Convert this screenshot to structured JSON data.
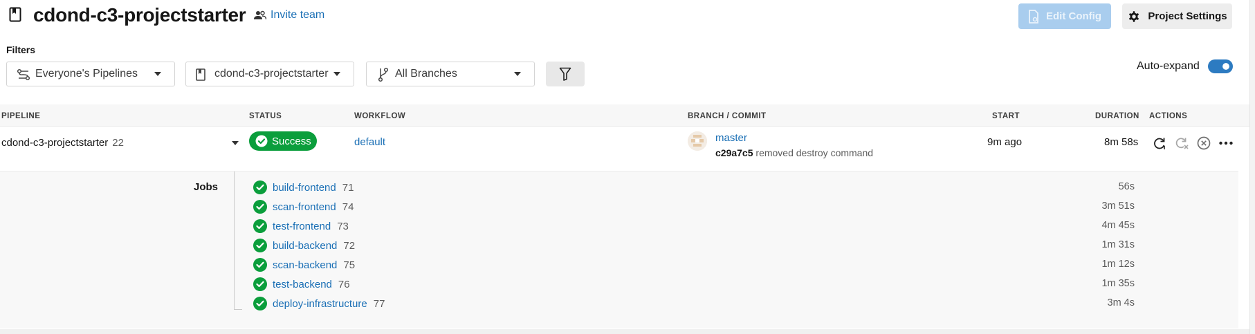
{
  "header": {
    "project_title": "cdond-c3-projectstarter",
    "invite_label": "Invite team",
    "edit_config_label": "Edit Config",
    "project_settings_label": "Project Settings"
  },
  "filters": {
    "label": "Filters",
    "pipelines_select": "Everyone's Pipelines",
    "project_select": "cdond-c3-projectstarter",
    "branches_select": "All Branches",
    "auto_expand_label": "Auto-expand",
    "auto_expand_on": true
  },
  "table": {
    "columns": [
      "PIPELINE",
      "STATUS",
      "WORKFLOW",
      "BRANCH / COMMIT",
      "START",
      "DURATION",
      "ACTIONS"
    ]
  },
  "pipeline": {
    "name": "cdond-c3-projectstarter",
    "number": "22",
    "status": "Success",
    "workflow": "default",
    "branch": "master",
    "commit_hash": "c29a7c5",
    "commit_message": "removed destroy command",
    "start": "9m ago",
    "duration": "8m 58s"
  },
  "jobs": {
    "label": "Jobs",
    "items": [
      {
        "name": "build-frontend",
        "number": "71",
        "duration": "56s"
      },
      {
        "name": "scan-frontend",
        "number": "74",
        "duration": "3m 51s"
      },
      {
        "name": "test-frontend",
        "number": "73",
        "duration": "4m 45s"
      },
      {
        "name": "build-backend",
        "number": "72",
        "duration": "1m 31s"
      },
      {
        "name": "scan-backend",
        "number": "75",
        "duration": "1m 12s"
      },
      {
        "name": "test-backend",
        "number": "76",
        "duration": "1m 35s"
      },
      {
        "name": "deploy-infrastructure",
        "number": "77",
        "duration": "3m 4s"
      }
    ]
  },
  "colors": {
    "success": "#0b9e3c",
    "link": "#1a6fb5",
    "toggle_on": "#2d7bc1",
    "edit_config_disabled": "#a9cdee"
  },
  "icons": {
    "project": "bookmark-icon",
    "invite": "people-icon",
    "edit_config": "file-config-icon",
    "settings": "gear-icon",
    "pipelines_filter": "pipelines-icon",
    "branch": "branch-icon",
    "filter": "funnel-icon",
    "rerun": "rerun-icon",
    "rerun_failed": "rerun-failed-icon",
    "cancel": "cancel-icon",
    "more": "more-icon"
  }
}
